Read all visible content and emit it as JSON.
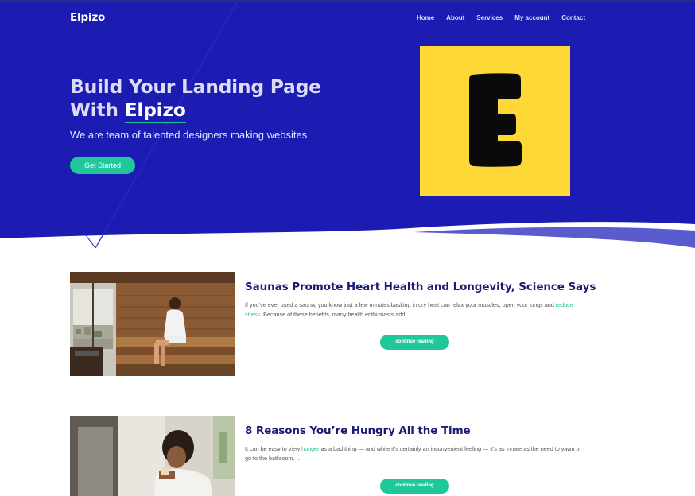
{
  "header": {
    "logo": "Elpizo",
    "nav": [
      "Home",
      "About",
      "Services",
      "My account",
      "Contact"
    ]
  },
  "hero": {
    "title_line1": "Build Your Landing Page",
    "title_with": "With ",
    "title_brand": "Elpizo",
    "subtitle": "We are team of talented designers making websites",
    "cta_label": "Get Started",
    "logo_letter": "E"
  },
  "posts": [
    {
      "title": "Saunas Promote Heart Health and Longevity, Science Says",
      "excerpt_before": "If you’ve ever used a sauna, you know just a few minutes basking in dry heat can relax your muscles, open your lungs and ",
      "excerpt_link": "reduce stress",
      "excerpt_after": ". Because of these benefits, many health enthusiasts add …",
      "button": "continue reading"
    },
    {
      "title": "8 Reasons You’re Hungry All the Time",
      "excerpt_before": "It can be easy to view ",
      "excerpt_link": "hunger",
      "excerpt_after": " as a bad thing — and while it’s certainly an inconvenient feeling — it’s as innate as the need to yawn or go to the bathroom. …",
      "button": "continue reading"
    }
  ],
  "colors": {
    "hero_bg": "#1a1ab0",
    "accent": "#1fc79a",
    "logo_bg": "#fdd836",
    "post_title": "#1b1b74"
  }
}
